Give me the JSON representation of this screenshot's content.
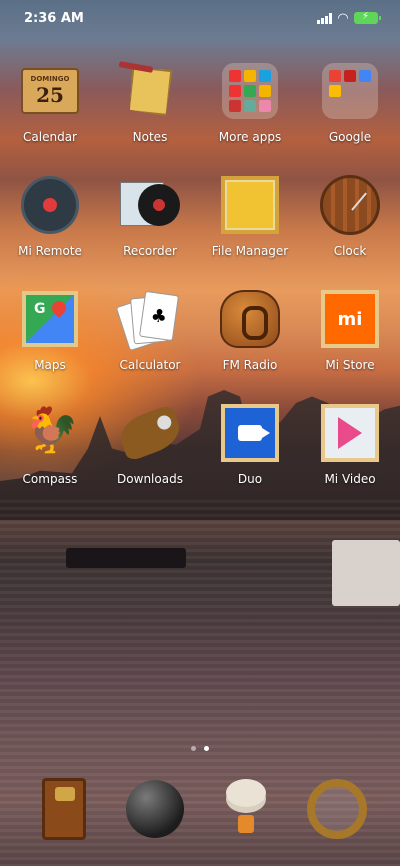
{
  "status": {
    "time": "2:36 AM"
  },
  "apps": [
    {
      "label": "Calendar",
      "icon": "calendar-icon",
      "date_day": "25"
    },
    {
      "label": "Notes",
      "icon": "notes-icon"
    },
    {
      "label": "More apps",
      "icon": "folder-icon"
    },
    {
      "label": "Google",
      "icon": "folder-icon"
    },
    {
      "label": "Mi Remote",
      "icon": "remote-icon"
    },
    {
      "label": "Recorder",
      "icon": "recorder-icon"
    },
    {
      "label": "File Manager",
      "icon": "file-manager-icon"
    },
    {
      "label": "Clock",
      "icon": "clock-icon"
    },
    {
      "label": "Maps",
      "icon": "maps-icon"
    },
    {
      "label": "Calculator",
      "icon": "calculator-icon"
    },
    {
      "label": "FM Radio",
      "icon": "radio-icon"
    },
    {
      "label": "Mi Store",
      "icon": "mi-store-icon",
      "glyph": "mi"
    },
    {
      "label": "Compass",
      "icon": "compass-icon"
    },
    {
      "label": "Downloads",
      "icon": "downloads-icon"
    },
    {
      "label": "Duo",
      "icon": "duo-icon"
    },
    {
      "label": "Mi Video",
      "icon": "mi-video-icon"
    }
  ],
  "dock": [
    {
      "icon": "phone-icon"
    },
    {
      "icon": "messages-icon"
    },
    {
      "icon": "browser-icon"
    },
    {
      "icon": "camera-icon"
    }
  ],
  "page_indicator": {
    "pages": 2,
    "active": 2
  }
}
